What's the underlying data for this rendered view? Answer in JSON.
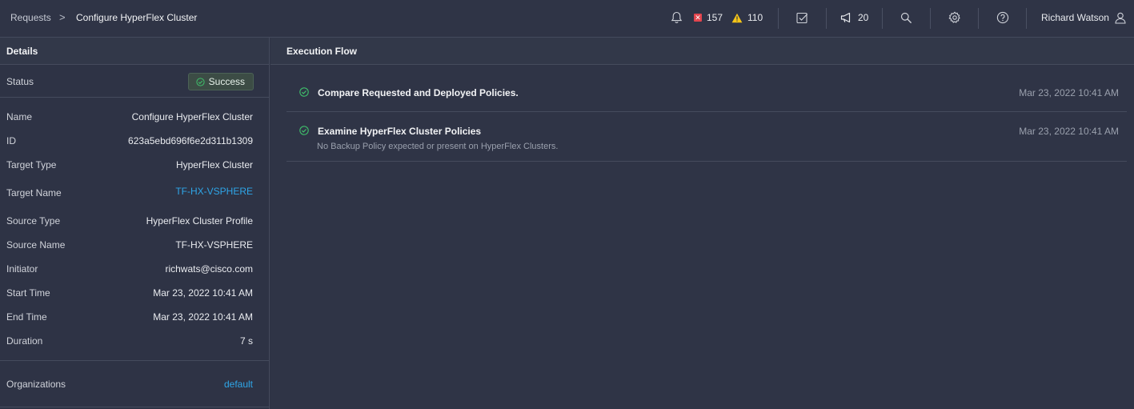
{
  "header": {
    "breadcrumb_parent": "Requests",
    "breadcrumb_separator": ">",
    "breadcrumb_current": "Configure HyperFlex Cluster",
    "critical_count": "157",
    "warning_count": "110",
    "announcement_count": "20",
    "user_name": "Richard Watson",
    "icons": [
      "bell-icon",
      "critical-alarm-icon",
      "warning-icon",
      "tasks-icon",
      "megaphone-icon",
      "search-icon",
      "gear-icon",
      "help-icon",
      "user-icon"
    ]
  },
  "details": {
    "title": "Details",
    "status_label": "Status",
    "status_value": "Success",
    "fields": [
      {
        "label": "Name",
        "value": "Configure HyperFlex Cluster"
      },
      {
        "label": "ID",
        "value": "623a5ebd696f6e2d311b1309"
      },
      {
        "label": "Target Type",
        "value": "HyperFlex Cluster"
      },
      {
        "label": "Target Name",
        "value": "TF-HX-VSPHERE"
      },
      {
        "label": "Source Type",
        "value": "HyperFlex Cluster Profile"
      },
      {
        "label": "Source Name",
        "value": "TF-HX-VSPHERE"
      },
      {
        "label": "Initiator",
        "value": "richwats@cisco.com"
      },
      {
        "label": "Start Time",
        "value": "Mar 23, 2022 10:41 AM"
      },
      {
        "label": "End Time",
        "value": "Mar 23, 2022 10:41 AM"
      },
      {
        "label": "Duration",
        "value": "7 s"
      }
    ],
    "organizations_label": "Organizations",
    "organizations_value": "default"
  },
  "execution_flow": {
    "title": "Execution Flow",
    "steps": [
      {
        "title": "Compare Requested and Deployed Policies.",
        "message": "",
        "time": "Mar 23, 2022 10:41 AM"
      },
      {
        "title": "Examine HyperFlex Cluster Policies",
        "message": "No Backup Policy expected or present on HyperFlex Clusters.",
        "time": "Mar 23, 2022 10:41 AM"
      }
    ]
  },
  "colors": {
    "background": "#2e3345",
    "link": "#2ea6e8",
    "success": "#3fbf6b",
    "critical": "#e2454e",
    "warning": "#f5c518"
  }
}
